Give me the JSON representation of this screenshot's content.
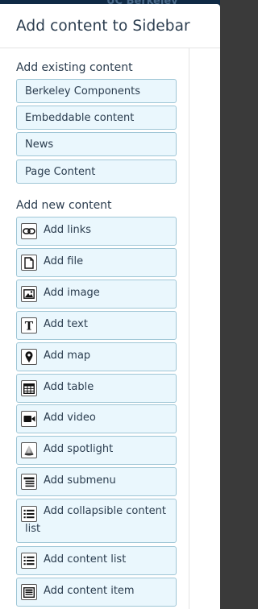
{
  "dialog": {
    "title": "Add content to Sidebar"
  },
  "background": {
    "title_fragment": "UC Berkeley"
  },
  "existing": {
    "heading": "Add existing content",
    "items": [
      {
        "label": "Berkeley Components"
      },
      {
        "label": "Embeddable content"
      },
      {
        "label": "News"
      },
      {
        "label": "Page Content"
      }
    ]
  },
  "new_content": {
    "heading": "Add new content",
    "items": [
      {
        "label": "Add links",
        "icon": "link-icon"
      },
      {
        "label": "Add file",
        "icon": "file-icon"
      },
      {
        "label": "Add image",
        "icon": "image-icon"
      },
      {
        "label": "Add text",
        "icon": "text-icon"
      },
      {
        "label": "Add map",
        "icon": "map-pin-icon"
      },
      {
        "label": "Add table",
        "icon": "table-icon"
      },
      {
        "label": "Add video",
        "icon": "video-camera-icon"
      },
      {
        "label": "Add spotlight",
        "icon": "spotlight-icon"
      },
      {
        "label": "Add submenu",
        "icon": "submenu-icon"
      },
      {
        "label": "Add collapsible content list",
        "icon": "list-icon"
      },
      {
        "label": "Add content list",
        "icon": "list-icon"
      },
      {
        "label": "Add content item",
        "icon": "content-item-icon"
      }
    ]
  },
  "colors": {
    "button_bg": "#eaf7fd",
    "button_border": "#9fc6d6",
    "text": "#2b3d4f"
  }
}
